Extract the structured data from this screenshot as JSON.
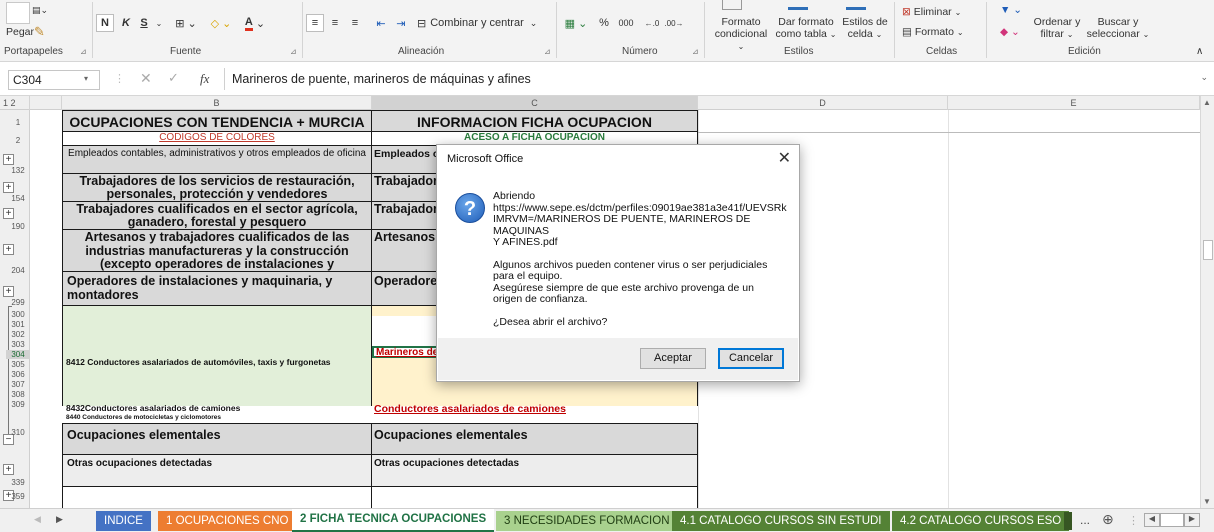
{
  "ribbon": {
    "paste": "Pegar",
    "groups": {
      "portapapeles": "Portapapeles",
      "fuente": "Fuente",
      "alineacion": "Alineación",
      "numero": "Número",
      "estilos": "Estilos",
      "celdas": "Celdas",
      "edicion": "Edición"
    },
    "bold": "N",
    "italic": "K",
    "underline": "S",
    "merge_center": "Combinar y centrar",
    "percent": "%",
    "thousands": "000",
    "formato_condicional_1": "Formato",
    "formato_condicional_2": "condicional",
    "dar_formato_1": "Dar formato",
    "dar_formato_2": "como tabla",
    "estilos_celda_1": "Estilos de",
    "estilos_celda_2": "celda",
    "eliminar": "Eliminar",
    "formato": "Formato",
    "ordenar_1": "Ordenar y",
    "ordenar_2": "filtrar",
    "buscar_1": "Buscar y",
    "buscar_2": "seleccionar"
  },
  "formula_bar": {
    "name_box": "C304",
    "fx": "fx",
    "formula": "Marineros de puente, marineros de máquinas y afines"
  },
  "grid": {
    "outline_levels": "1 2",
    "columns": [
      "B",
      "C",
      "D",
      "E"
    ],
    "rows": {
      "r1": "1",
      "r2": "2",
      "r132": "132",
      "r154": "154",
      "r190": "190",
      "r204": "204",
      "r299": "299",
      "r300": "300",
      "r301": "301",
      "r302": "302",
      "r303": "303",
      "r304": "304",
      "r305": "305",
      "r306": "306",
      "r307": "307",
      "r308": "308",
      "r309": "309",
      "r310": "310",
      "r339": "339",
      "r359": "359"
    },
    "b1": "OCUPACIONES CON TENDENCIA + MURCIA",
    "c1": "INFORMACION FICHA OCUPACION",
    "b2": "CODIGOS DE COLORES",
    "c2": "ACESO A  FICHA OCUPACION",
    "b132": "Empleados contables, administrativos y otros empleados de oficina",
    "c132": "Empleados c oficina",
    "b154": "Trabajadores de los servicios de restauración, personales, protección y vendedores",
    "c154": "Trabajador personales",
    "b190": "Trabajadores cualificados en el sector agrícola, ganadero, forestal y pesquero",
    "c190": "Trabajador ganadero,",
    "b204": "Artesanos y trabajadores cualificados de las industrias manufactureras y la construcción (excepto operadores de instalaciones y maquinaria)",
    "c204": "Artesanos y manufactu de instalac",
    "b299": "Operadores de instalaciones y maquinaria, y montadores",
    "c299": "Operadore",
    "c304": "Marineros de",
    "b305": "8412 Conductores asalariados de automóviles, taxis y furgonetas",
    "b308": "8432Conductores asalariados de camiones",
    "c308": "Conductores asalariados de camiones",
    "b309": "8440 Conductores de motocicletas y ciclomotores",
    "b310": "Ocupaciones elementales",
    "c310": "Ocupaciones elementales",
    "b339": "Otras  ocupaciones detectadas",
    "c339": "Otras  ocupaciones detectadas"
  },
  "tabs": [
    {
      "label": "INDICE",
      "color": "#4472c4"
    },
    {
      "label": "1 OCUPACIONES CNO",
      "color": "#ed7d31"
    },
    {
      "label": "2 FICHA TECNICA OCUPACIONES",
      "color": "#ffffff",
      "active": true
    },
    {
      "label": "3 NECESIDADES FORMACION",
      "color": "#a9d18e"
    },
    {
      "label": "4.1 CATALOGO CURSOS SIN ESTUDI",
      "color": "#548235"
    },
    {
      "label": "4.2 CATALOGO CURSOS ESO",
      "color": "#548235"
    }
  ],
  "tabs_more": "...",
  "dialog": {
    "title": "Microsoft Office",
    "line_open": "Abriendo",
    "url1": "https://www.sepe.es/dctm/perfiles:09019ae381a3e41f/UEVSRk",
    "url2": "IMRVM=/MARINEROS DE PUENTE, MARINEROS DE MAQUINAS",
    "url3": "Y AFINES.pdf",
    "warn1": "Algunos archivos pueden contener virus o ser perjudiciales",
    "warn2": "para el equipo.",
    "warn3": "Asegúrese siempre de que este archivo provenga de un",
    "warn4": "origen de confianza.",
    "question": "¿Desea abrir el archivo?",
    "ok": "Aceptar",
    "cancel": "Cancelar"
  }
}
